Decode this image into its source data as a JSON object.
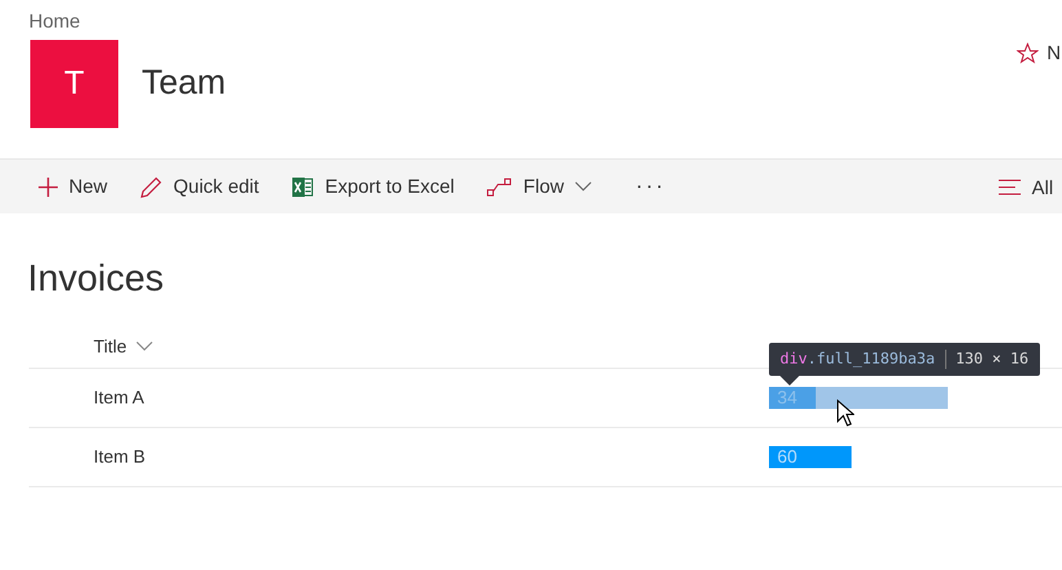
{
  "breadcrumb": "Home",
  "site": {
    "logo_letter": "T",
    "title": "Team",
    "follow_label": "N"
  },
  "commands": [
    {
      "kind": "new",
      "label": "New"
    },
    {
      "kind": "edit",
      "label": "Quick edit"
    },
    {
      "kind": "excel",
      "label": "Export to Excel"
    },
    {
      "kind": "flow",
      "label": "Flow"
    },
    {
      "kind": "more",
      "label": "···"
    }
  ],
  "view_label": "All",
  "list_title": "Invoices",
  "columns": [
    {
      "label": "Title"
    }
  ],
  "rows": [
    {
      "title": "Item A",
      "value": "34",
      "highlighted": true
    },
    {
      "title": "Item B",
      "value": "60",
      "highlighted": false
    }
  ],
  "tooltip": {
    "tag": "div",
    "class_name": ".full_1189ba3a",
    "size": "130 × 16"
  }
}
